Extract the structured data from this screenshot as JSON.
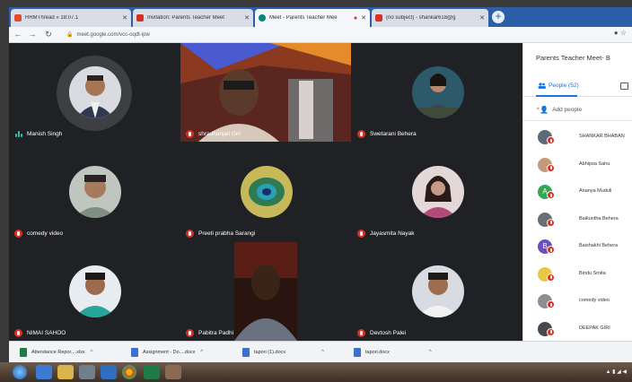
{
  "browser": {
    "tabs": [
      {
        "title": "HRMThread » 18:07.1",
        "fav_color": "#e04b2f"
      },
      {
        "title": "Invitation: Parents Teacher Meet",
        "fav_color": "#d93025"
      },
      {
        "title": "Meet - Parents Teacher Mee",
        "fav_color": "#00897b"
      },
      {
        "title": "(no subject) - shankar618@g",
        "fav_color": "#d93025"
      }
    ],
    "url": "meet.google.com/vcc-oqdt-ipw"
  },
  "tiles": [
    {
      "name": "Manish Singh",
      "speaking": true
    },
    {
      "name": "shradhanjali Giri"
    },
    {
      "name": "Swetarani Behera"
    },
    {
      "name": "comedy video"
    },
    {
      "name": "Preeti prabha Sarangi"
    },
    {
      "name": "Jayasmita Nayak"
    },
    {
      "name": "NIMAI SAHOO"
    },
    {
      "name": "Pabitra Padhi"
    },
    {
      "name": "Devtosh Palei"
    }
  ],
  "panel": {
    "title": "Parents Teacher Meet- B",
    "people_tab": "People (52)",
    "add_people": "Add people",
    "participants": [
      {
        "name": "SHANKAR BHABAN",
        "avatar_letter": "",
        "color": "#5b6b7a"
      },
      {
        "name": "Abhipsa Sahu",
        "avatar_letter": "",
        "color": "#c59a7a"
      },
      {
        "name": "Ananya Muduli",
        "avatar_letter": "A",
        "color": "#33a852"
      },
      {
        "name": "Baikuntha Behera",
        "avatar_letter": "",
        "color": "#6a6f75"
      },
      {
        "name": "Baishakhi Behera",
        "avatar_letter": "B",
        "color": "#6b4fbb"
      },
      {
        "name": "Bindu Smita",
        "avatar_letter": "",
        "color": "#e8c843"
      },
      {
        "name": "comedy video",
        "avatar_letter": "",
        "color": "#8a8f96"
      },
      {
        "name": "DEEPAK GIRI",
        "avatar_letter": "",
        "color": "#454a50"
      }
    ]
  },
  "downloads": [
    {
      "label": "Attendance Repor....xlsx"
    },
    {
      "label": "Assignment - Do....docx"
    },
    {
      "label": "tapori (1).docx"
    },
    {
      "label": "tapori.docx"
    }
  ],
  "colors": {
    "meet_bg": "#202124",
    "mic_off": "#d93025",
    "accent": "#1a73e8"
  }
}
